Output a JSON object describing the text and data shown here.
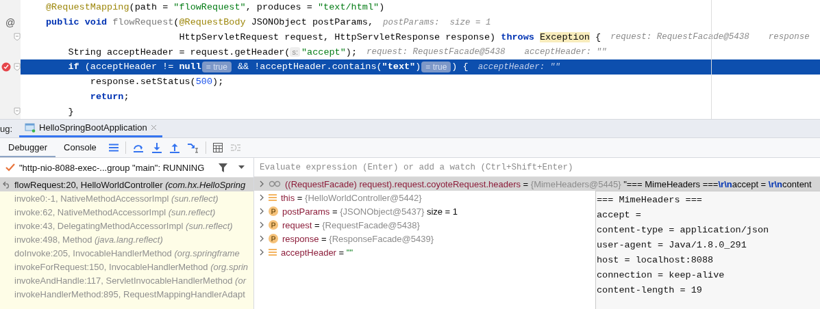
{
  "editor": {
    "lines": [
      {
        "current": false,
        "breakpoint": false,
        "fold": false,
        "segments": [
          {
            "kind": "code",
            "tokens": [
              {
                "kind": "annotation",
                "text": "@RequestMapping"
              },
              {
                "kind": "plain",
                "text": "(path = "
              },
              {
                "kind": "string",
                "text": "\"flowRequest\""
              },
              {
                "kind": "plain",
                "text": ", produces = "
              },
              {
                "kind": "string",
                "text": "\"text/html\""
              },
              {
                "kind": "plain",
                "text": ")"
              }
            ]
          }
        ]
      },
      {
        "current": false,
        "breakpoint": false,
        "fold": false,
        "gutter_mark": "@",
        "segments": [
          {
            "kind": "code",
            "tokens": [
              {
                "kind": "keyword",
                "text": "public"
              },
              {
                "kind": "keyword",
                "text": " void"
              },
              {
                "kind": "unused",
                "text": " flowRequest"
              },
              {
                "kind": "plain",
                "text": "("
              },
              {
                "kind": "annotation",
                "text": "@RequestBody"
              },
              {
                "kind": "plain",
                "text": " JSONObject postParams,"
              }
            ]
          },
          {
            "kind": "hint",
            "text": "postParams:  size = 1"
          }
        ],
        "children": [
          {
            "kind": "continuation",
            "current": false,
            "breakpoint": false,
            "fold": true,
            "segments": [
              {
                "kind": "code",
                "tokens": [
                  {
                    "kind": "plain",
                    "text": "HttpServletRequest request, HttpServletResponse response) "
                  },
                  {
                    "kind": "keyword",
                    "text": "throws "
                  },
                  {
                    "kind": "marked",
                    "text": "Exception"
                  },
                  {
                    "kind": "plain",
                    "text": " {"
                  }
                ]
              },
              {
                "kind": "hint",
                "text": "request: RequestFacade@5438"
              },
              {
                "kind": "hint",
                "text": "response"
              }
            ]
          },
          {
            "current": false,
            "breakpoint": false,
            "fold": false,
            "segments": [
              {
                "kind": "code",
                "tokens": [
                  {
                    "kind": "plain",
                    "text": "String acceptHeader = request.getHeader("
                  }
                ]
              },
              {
                "kind": "param",
                "text": "s:"
              },
              {
                "kind": "code",
                "tokens": [
                  {
                    "kind": "string",
                    "text": "\"accept\""
                  },
                  {
                    "kind": "plain",
                    "text": ");"
                  }
                ]
              },
              {
                "kind": "hint",
                "text": "request: RequestFacade@5438"
              },
              {
                "kind": "hint",
                "text": "acceptHeader: \"\""
              }
            ]
          },
          {
            "current": true,
            "breakpoint": true,
            "fold": true,
            "segments": [
              {
                "kind": "code",
                "tokens": [
                  {
                    "kind": "keyword",
                    "text": "if"
                  },
                  {
                    "kind": "plain",
                    "text": " (acceptHeader != "
                  },
                  {
                    "kind": "keyword",
                    "text": "null"
                  }
                ]
              },
              {
                "kind": "badge",
                "text": "= true"
              },
              {
                "kind": "code",
                "tokens": [
                  {
                    "kind": "plain",
                    "text": " && !acceptHeader.contains("
                  },
                  {
                    "kind": "string",
                    "text": "\"text\""
                  },
                  {
                    "kind": "plain",
                    "text": ")"
                  }
                ]
              },
              {
                "kind": "badge",
                "text": "= true"
              },
              {
                "kind": "code",
                "tokens": [
                  {
                    "kind": "plain",
                    "text": ") {"
                  }
                ]
              },
              {
                "kind": "hint",
                "text": "acceptHeader: \"\""
              }
            ],
            "children": [
              {
                "current": false,
                "breakpoint": false,
                "fold": false,
                "segments": [
                  {
                    "kind": "code",
                    "tokens": [
                      {
                        "kind": "plain",
                        "text": "response.setStatus("
                      },
                      {
                        "kind": "number",
                        "text": "500"
                      },
                      {
                        "kind": "plain",
                        "text": ");"
                      }
                    ]
                  }
                ]
              },
              {
                "current": false,
                "breakpoint": false,
                "fold": false,
                "segments": [
                  {
                    "kind": "code",
                    "tokens": [
                      {
                        "kind": "keyword",
                        "text": "return"
                      },
                      {
                        "kind": "plain",
                        "text": ";"
                      }
                    ]
                  }
                ]
              }
            ]
          },
          {
            "current": false,
            "breakpoint": false,
            "fold": true,
            "segments": [
              {
                "kind": "code",
                "tokens": [
                  {
                    "kind": "plain",
                    "text": "}"
                  }
                ]
              }
            ]
          }
        ]
      }
    ]
  },
  "debug": {
    "label": "ug:",
    "session_tab": {
      "title": "HelloSpringBootApplication",
      "selected": true
    },
    "view_tabs": [
      {
        "label": "Debugger",
        "selected": true
      },
      {
        "label": "Console",
        "selected": false
      }
    ],
    "thread": "\"http-nio-8088-exec-...group \"main\": RUNNING",
    "frames": [
      {
        "method": "flowRequest:20, HelloWorldController",
        "package": "(com.hx.HelloSpring",
        "selected": true
      },
      {
        "method": "invoke0:-1, NativeMethodAccessorImpl",
        "package": "(sun.reflect)",
        "selected": false
      },
      {
        "method": "invoke:62, NativeMethodAccessorImpl",
        "package": "(sun.reflect)",
        "selected": false
      },
      {
        "method": "invoke:43, DelegatingMethodAccessorImpl",
        "package": "(sun.reflect)",
        "selected": false
      },
      {
        "method": "invoke:498, Method",
        "package": "(java.lang.reflect)",
        "selected": false
      },
      {
        "method": "doInvoke:205, InvocableHandlerMethod",
        "package": "(org.springframe",
        "selected": false
      },
      {
        "method": "invokeForRequest:150, InvocableHandlerMethod",
        "package": "(org.sprin",
        "selected": false
      },
      {
        "method": "invokeAndHandle:117, ServletInvocableHandlerMethod",
        "package": "(or",
        "selected": false
      },
      {
        "method": "invokeHandlerMethod:895, RequestMappingHandlerAdapt",
        "selected": false
      }
    ],
    "evaluate": {
      "placeholder": "Evaluate expression (Enter) or add a watch (Ctrl+Shift+Enter)"
    },
    "variables": [
      {
        "kind": "watch",
        "name": "((RequestFacade) request).request.coyoteRequest.headers",
        "operator": "=",
        "value": "{MimeHeaders@5445}",
        "extra": "\"=== MimeHeaders ===**\\r\\n**accept = **\\r\\n**content",
        "selected": true
      },
      {
        "kind": "field",
        "name": "this",
        "operator": "=",
        "value": "{HelloWorldController@5442}",
        "selected": false
      },
      {
        "kind": "param",
        "name": "postParams",
        "operator": "=",
        "value": "{JSONObject@5437}",
        "extra": "size = 1",
        "selected": false
      },
      {
        "kind": "param",
        "name": "request",
        "operator": "=",
        "value": "{RequestFacade@5438}",
        "selected": false
      },
      {
        "kind": "param",
        "name": "response",
        "operator": "=",
        "value": "{ResponseFacade@5439}",
        "selected": false
      },
      {
        "kind": "field",
        "name": "acceptHeader",
        "operator": "=",
        "value": "\"\"",
        "string_value": true,
        "selected": false
      }
    ],
    "popup": {
      "lines": [
        "=== MimeHeaders ===",
        "accept =",
        "content-type = application/json",
        "user-agent = Java/1.8.0_291",
        "host = localhost:8088",
        "connection = keep-alive",
        "content-length = 19"
      ]
    }
  }
}
